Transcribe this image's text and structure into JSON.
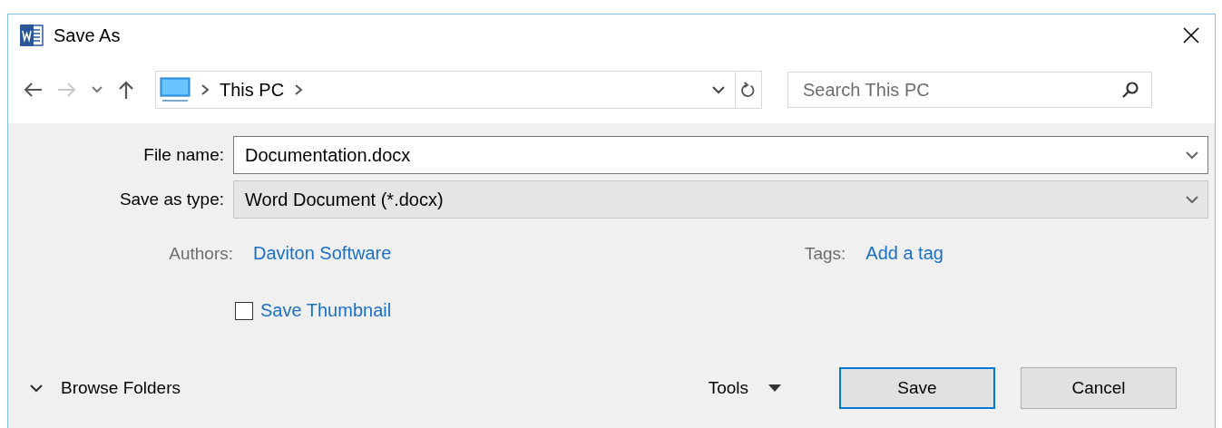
{
  "window": {
    "title": "Save As"
  },
  "navigation": {
    "breadcrumb": [
      "This PC"
    ],
    "search": {
      "placeholder": "Search This PC"
    }
  },
  "fields": [
    {
      "label": "File name:",
      "value": "Documentation.docx",
      "kind": "input"
    },
    {
      "label": "Save as type:",
      "value": "Word Document (*.docx)",
      "kind": "select"
    }
  ],
  "metadata": [
    {
      "label": "Authors:",
      "value": "Daviton Software"
    },
    {
      "label": "Tags:",
      "value": "Add a tag"
    }
  ],
  "save_thumbnail": {
    "label": "Save Thumbnail",
    "checked": false
  },
  "footer": {
    "browse_folders": "Browse Folders",
    "tools": "Tools",
    "buttons": [
      {
        "label": "Save",
        "default": true
      },
      {
        "label": "Cancel",
        "default": false
      }
    ]
  }
}
